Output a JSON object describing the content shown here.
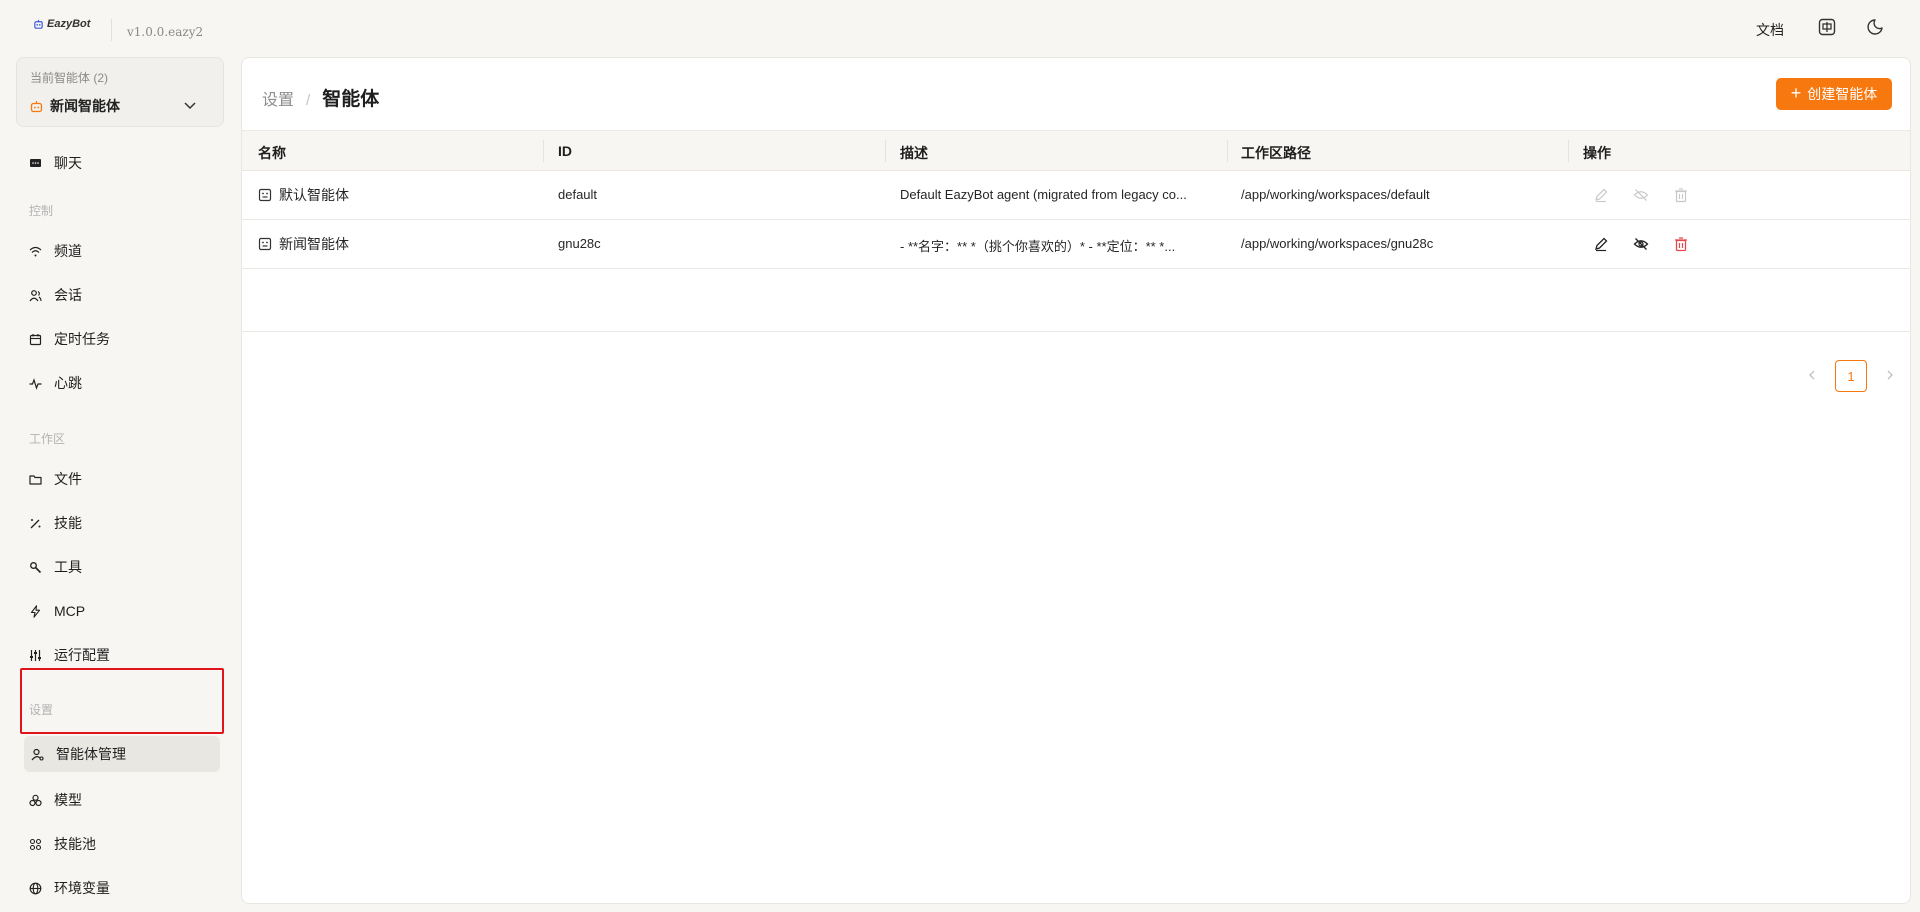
{
  "topbar": {
    "logo_text": "EazyBot",
    "version": "v1.0.0.eazy2",
    "docs_label": "文档",
    "lang_icon": "language-icon",
    "theme_icon": "moon-icon"
  },
  "sidebar": {
    "current_agent_caption": "当前智能体 (2)",
    "current_agent_name": "新闻智能体",
    "chat_label": "聊天",
    "group_control": "控制",
    "control_items": [
      "频道",
      "会话",
      "定时任务",
      "心跳"
    ],
    "group_workspace": "工作区",
    "workspace_items": [
      "文件",
      "技能",
      "工具",
      "MCP",
      "运行配置"
    ],
    "group_settings": "设置",
    "settings_items": [
      "智能体管理",
      "模型",
      "技能池",
      "环境变量"
    ]
  },
  "main": {
    "breadcrumb_parent": "设置",
    "breadcrumb_sep": "/",
    "breadcrumb_current": "智能体",
    "create_button": "创建智能体",
    "columns": [
      "名称",
      "ID",
      "描述",
      "工作区路径",
      "操作"
    ],
    "rows": [
      {
        "name": "默认智能体",
        "id": "default",
        "description": "Default EazyBot agent (migrated from legacy co...",
        "workspace": "/app/working/workspaces/default",
        "actions_enabled": false
      },
      {
        "name": "新闻智能体",
        "id": "gnu28c",
        "description": "- **名字：** *（挑个你喜欢的）* - **定位：** *...",
        "workspace": "/app/working/workspaces/gnu28c",
        "actions_enabled": true
      }
    ],
    "pagination": {
      "current_page": "1"
    }
  },
  "colors": {
    "accent": "#f7780f",
    "danger": "#e5484d",
    "highlight": "#e0151b"
  }
}
